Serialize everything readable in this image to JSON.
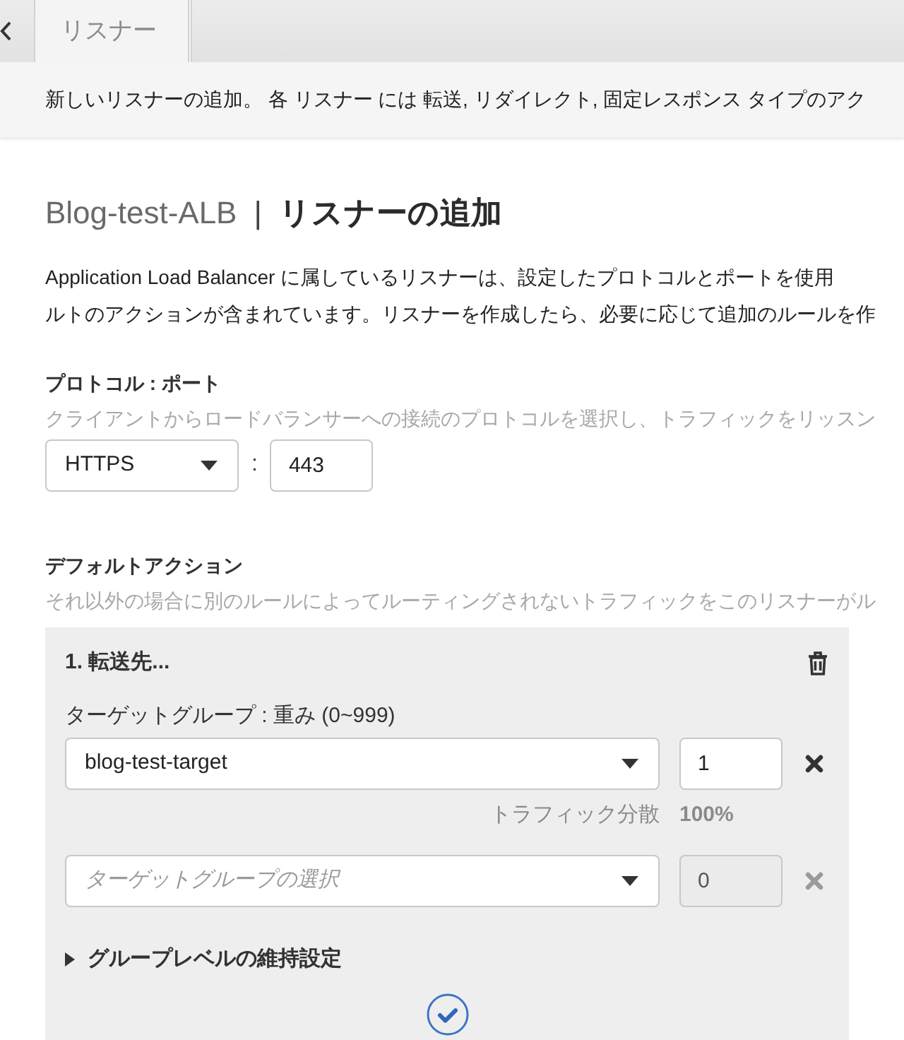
{
  "tabs": [
    {
      "label": "リスナー",
      "selected": true
    }
  ],
  "info_bar": {
    "text": "新しいリスナーの追加。 各 リスナー には 転送, リダイレクト, 固定レスポンス タイプのアク"
  },
  "page_title": {
    "resource": "Blog-test-ALB",
    "separator": "|",
    "title": "リスナーの追加"
  },
  "description_lines": [
    "Application Load Balancer に属しているリスナーは、設定したプロトコルとポートを使用",
    "ルトのアクションが含まれています。リスナーを作成したら、必要に応じて追加のルールを作"
  ],
  "protocol_port": {
    "label": "プロトコル : ポート",
    "hint": "クライアントからロードバランサーへの接続のプロトコルを選択し、トラフィックをリッスン",
    "protocol": "HTTPS",
    "separator": ":",
    "port": "443"
  },
  "default_action": {
    "label": "デフォルトアクション",
    "hint": "それ以外の場合に別のルールによってルーティングされないトラフィックをこのリスナーがル",
    "actions": [
      {
        "heading": "1. 転送先...",
        "target_groups_label": "ターゲットグループ : 重み (0~999)",
        "target_groups": [
          {
            "value": "blog-test-target",
            "weight": "1",
            "disabled": false,
            "distribution": {
              "label": "トラフィック分散",
              "value": "100%"
            }
          },
          {
            "placeholder": "ターゲットグループの選択",
            "weight": "0",
            "disabled": true
          }
        ],
        "stickiness": {
          "label": "グループレベルの維持設定",
          "expanded": false
        }
      }
    ]
  }
}
